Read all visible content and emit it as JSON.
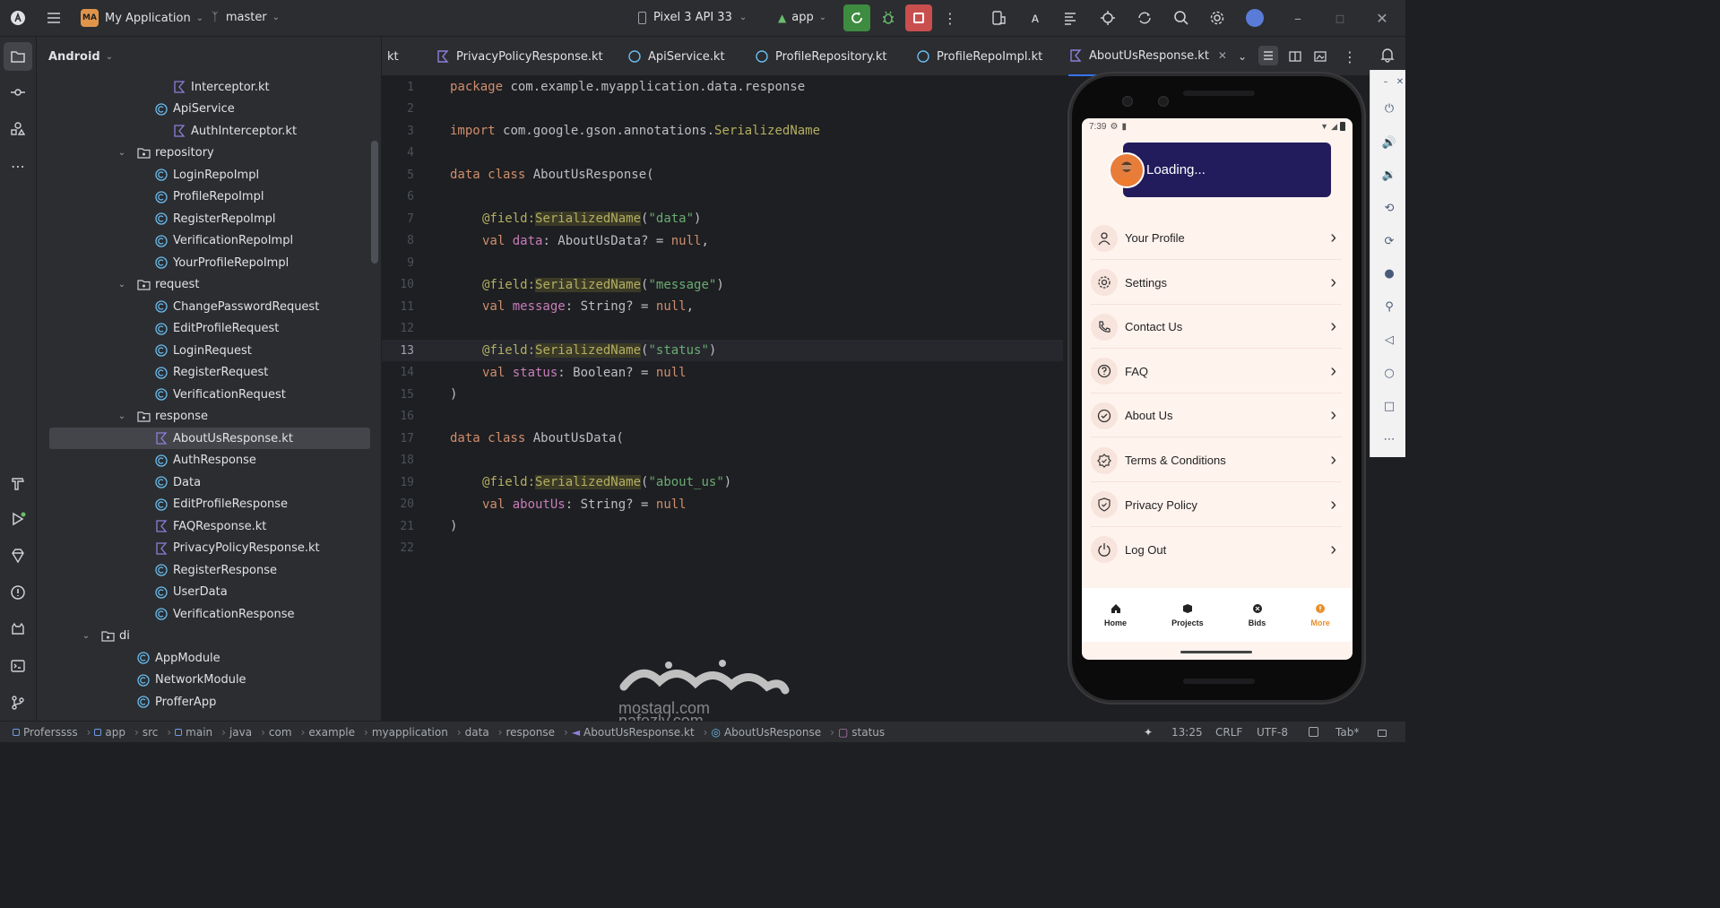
{
  "title_bar": {
    "project_badge": "MA",
    "project_name": "My Application",
    "branch": "master",
    "device": "Pixel 3 API 33",
    "run_config": "app"
  },
  "project_panel": {
    "view_mode": "Android",
    "tree": [
      {
        "label": "Interceptor.kt",
        "kind": "file"
      },
      {
        "label": "ApiService",
        "kind": "class"
      },
      {
        "label": "AuthInterceptor.kt",
        "kind": "file"
      },
      {
        "label": "repository",
        "kind": "folder"
      },
      {
        "label": "LoginRepoImpl",
        "kind": "class"
      },
      {
        "label": "ProfileRepoImpl",
        "kind": "class"
      },
      {
        "label": "RegisterRepoImpl",
        "kind": "class"
      },
      {
        "label": "VerificationRepoImpl",
        "kind": "class"
      },
      {
        "label": "YourProfileRepoImpl",
        "kind": "class"
      },
      {
        "label": "request",
        "kind": "folder"
      },
      {
        "label": "ChangePasswordRequest",
        "kind": "class"
      },
      {
        "label": "EditProfileRequest",
        "kind": "class"
      },
      {
        "label": "LoginRequest",
        "kind": "class"
      },
      {
        "label": "RegisterRequest",
        "kind": "class"
      },
      {
        "label": "VerificationRequest",
        "kind": "class"
      },
      {
        "label": "response",
        "kind": "folder"
      },
      {
        "label": "AboutUsResponse.kt",
        "kind": "file",
        "selected": true
      },
      {
        "label": "AuthResponse",
        "kind": "class"
      },
      {
        "label": "Data",
        "kind": "class"
      },
      {
        "label": "EditProfileResponse",
        "kind": "class"
      },
      {
        "label": "FAQResponse.kt",
        "kind": "file"
      },
      {
        "label": "PrivacyPolicyResponse.kt",
        "kind": "file"
      },
      {
        "label": "RegisterResponse",
        "kind": "class"
      },
      {
        "label": "UserData",
        "kind": "class"
      },
      {
        "label": "VerificationResponse",
        "kind": "class"
      },
      {
        "label": "di",
        "kind": "folder"
      },
      {
        "label": "AppModule",
        "kind": "class"
      },
      {
        "label": "NetworkModule",
        "kind": "class"
      },
      {
        "label": "ProfferApp",
        "kind": "class"
      }
    ]
  },
  "editor_tabs": [
    {
      "label": "kt"
    },
    {
      "label": "PrivacyPolicyResponse.kt"
    },
    {
      "label": "ApiService.kt"
    },
    {
      "label": "ProfileRepository.kt"
    },
    {
      "label": "ProfileRepoImpl.kt"
    },
    {
      "label": "AboutUsResponse.kt",
      "active": true
    }
  ],
  "code_lines": [
    {
      "num": "1"
    },
    {
      "num": "2"
    },
    {
      "num": "3"
    },
    {
      "num": "4"
    },
    {
      "num": "5"
    },
    {
      "num": "6"
    },
    {
      "num": "7"
    },
    {
      "num": "8"
    },
    {
      "num": "9"
    },
    {
      "num": "10"
    },
    {
      "num": "11"
    },
    {
      "num": "12"
    },
    {
      "num": "13"
    },
    {
      "num": "14"
    },
    {
      "num": "15"
    },
    {
      "num": "16"
    },
    {
      "num": "17"
    },
    {
      "num": "18"
    },
    {
      "num": "19"
    },
    {
      "num": "20"
    },
    {
      "num": "21"
    },
    {
      "num": "22"
    }
  ],
  "code": {
    "l1a": "package ",
    "l1b": "com.example.myapplication.data.response",
    "l3a": "import ",
    "l3b": "com.google.gson.annotations.",
    "l3c": "SerializedName",
    "l5a": "data class ",
    "l5b": "AboutUsResponse(",
    "l7a": "@field:",
    "l7b": "SerializedName",
    "l7c": "(",
    "l7d": "\"data\"",
    "l7e": ")",
    "l8a": "val ",
    "l8b": "data",
    "l8c": ": AboutUsData? = ",
    "l8d": "null",
    "l8e": ",",
    "l10a": "@field:",
    "l10b": "SerializedName",
    "l10c": "(",
    "l10d": "\"message\"",
    "l10e": ")",
    "l11a": "val ",
    "l11b": "message",
    "l11c": ": String? = ",
    "l11d": "null",
    "l11e": ",",
    "l13a": "@field:",
    "l13b": "SerializedName",
    "l13c": "(",
    "l13d": "\"status\"",
    "l13e": ")",
    "l14a": "val ",
    "l14b": "status",
    "l14c": ": Boolean? = ",
    "l14d": "null",
    "l15": ")",
    "l17a": "data class ",
    "l17b": "AboutUsData(",
    "l19a": "@field:",
    "l19b": "SerializedName",
    "l19c": "(",
    "l19d": "\"about_us\"",
    "l19e": ")",
    "l20a": "val ",
    "l20b": "aboutUs",
    "l20c": ": String? = ",
    "l20d": "null",
    "l21": ")"
  },
  "emulator": {
    "time": "7:39",
    "profile_name": "Loading...",
    "menu": [
      {
        "label": "Your Profile",
        "icon": "user-icon"
      },
      {
        "label": "Settings",
        "icon": "gear-icon"
      },
      {
        "label": "Contact Us",
        "icon": "phone-icon"
      },
      {
        "label": "FAQ",
        "icon": "question-icon"
      },
      {
        "label": "About Us",
        "icon": "check-circle-icon"
      },
      {
        "label": "Terms & Conditions",
        "icon": "badge-icon"
      },
      {
        "label": "Privacy Policy",
        "icon": "shield-icon"
      },
      {
        "label": "Log Out",
        "icon": "power-icon"
      }
    ],
    "bottom_nav": [
      {
        "label": "Home"
      },
      {
        "label": "Projects"
      },
      {
        "label": "Bids"
      },
      {
        "label": "More",
        "active": true
      }
    ],
    "accent": "#e8902c",
    "card_color": "#221c5c"
  },
  "status_bar": {
    "breadcrumbs": [
      "Proferssss",
      "app",
      "src",
      "main",
      "java",
      "com",
      "example",
      "myapplication",
      "data",
      "response",
      "AboutUsResponse.kt",
      "AboutUsResponse",
      "status"
    ],
    "position": "13:25",
    "line_sep": "CRLF",
    "encoding": "UTF-8",
    "indent": "Tab*"
  },
  "watermark": {
    "text1": "mostaql.com",
    "text2": "nafezly.com"
  }
}
